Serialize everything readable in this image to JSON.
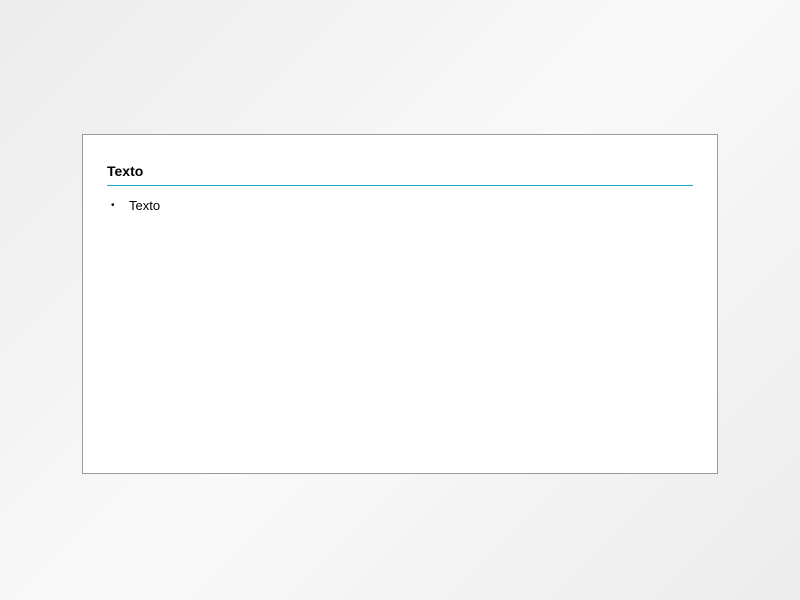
{
  "slide": {
    "title": "Texto",
    "bullets": [
      "Texto"
    ]
  }
}
